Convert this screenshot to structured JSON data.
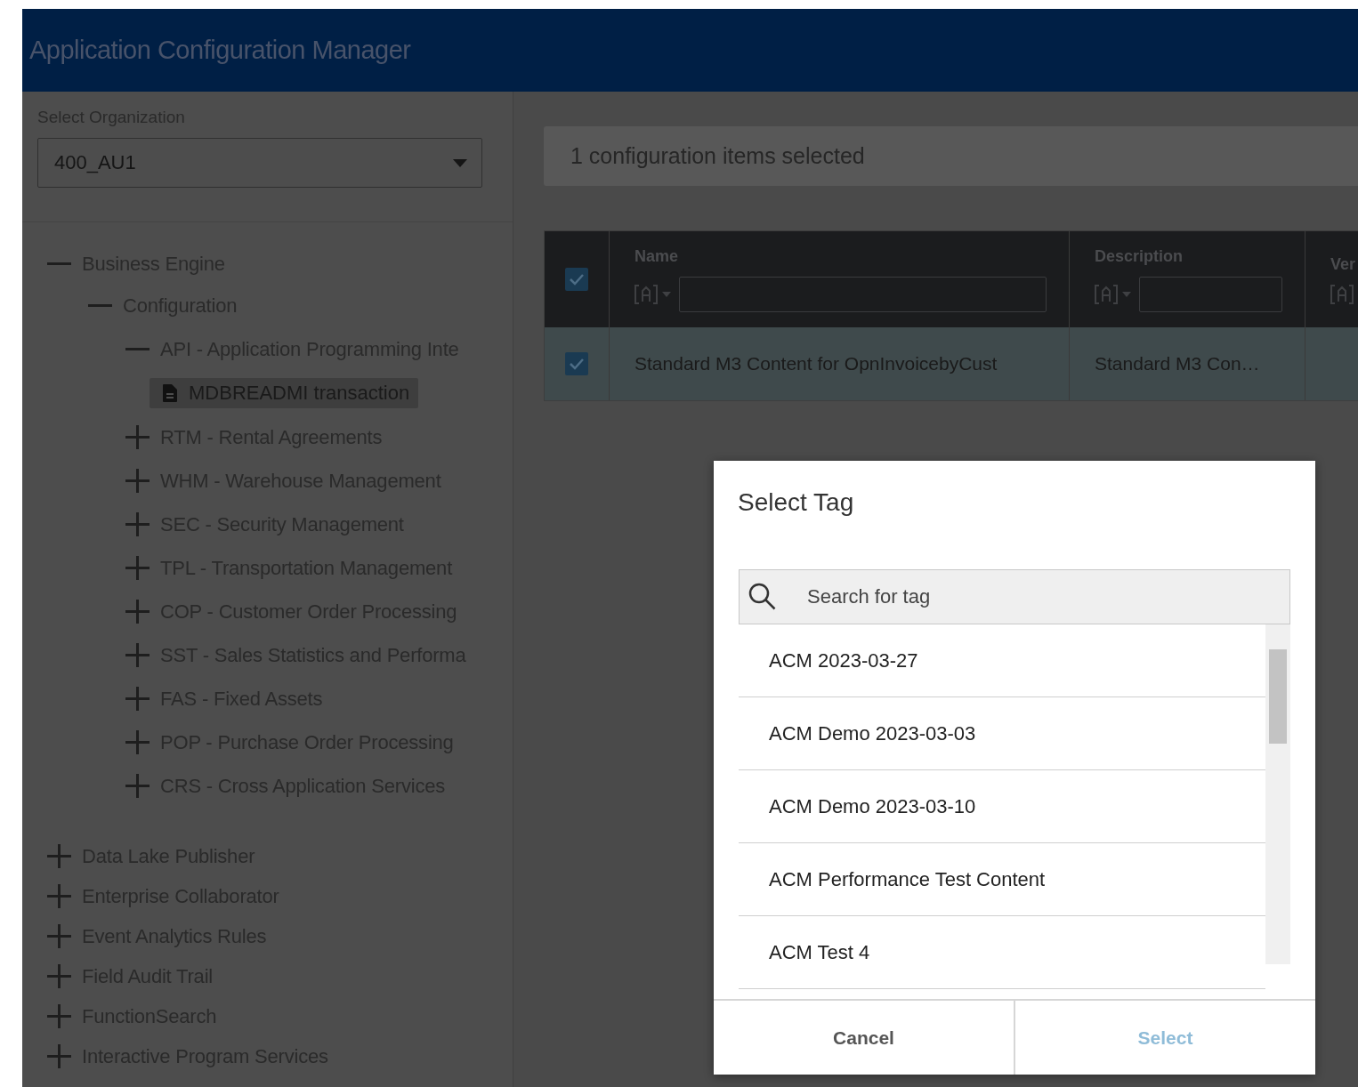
{
  "header": {
    "title": "Application Configuration Manager"
  },
  "organization": {
    "label": "Select Organization",
    "value": "400_AU1"
  },
  "tree": [
    {
      "kind": "branch",
      "label": "Business Engine",
      "expanded": true,
      "children": [
        {
          "kind": "branch",
          "label": "Configuration",
          "expanded": true,
          "children": [
            {
              "kind": "branch",
              "label": "API - Application Programming Inte",
              "expanded": true,
              "children": [
                {
                  "kind": "leaf",
                  "label": "MDBREADMI transaction",
                  "selected": true
                }
              ]
            },
            {
              "kind": "branch",
              "label": "RTM - Rental Agreements",
              "expanded": false
            },
            {
              "kind": "branch",
              "label": "WHM - Warehouse Management",
              "expanded": false
            },
            {
              "kind": "branch",
              "label": "SEC - Security Management",
              "expanded": false
            },
            {
              "kind": "branch",
              "label": "TPL - Transportation Management",
              "expanded": false
            },
            {
              "kind": "branch",
              "label": "COP - Customer Order Processing",
              "expanded": false
            },
            {
              "kind": "branch",
              "label": "SST - Sales Statistics and Performa",
              "expanded": false
            },
            {
              "kind": "branch",
              "label": "FAS - Fixed Assets",
              "expanded": false
            },
            {
              "kind": "branch",
              "label": "POP - Purchase Order Processing",
              "expanded": false
            },
            {
              "kind": "branch",
              "label": "CRS - Cross Application Services",
              "expanded": false
            }
          ]
        }
      ]
    },
    {
      "kind": "branch",
      "label": "Data Lake Publisher",
      "expanded": false
    },
    {
      "kind": "branch",
      "label": "Enterprise Collaborator",
      "expanded": false
    },
    {
      "kind": "branch",
      "label": "Event Analytics Rules",
      "expanded": false
    },
    {
      "kind": "branch",
      "label": "Field Audit Trail",
      "expanded": false
    },
    {
      "kind": "branch",
      "label": "FunctionSearch",
      "expanded": false
    },
    {
      "kind": "branch",
      "label": "Interactive Program Services",
      "expanded": false
    }
  ],
  "banner": "1 configuration items selected",
  "table": {
    "all_checked": true,
    "columns": [
      "Name",
      "Description",
      "Ver"
    ],
    "rows": [
      {
        "checked": true,
        "selected": true,
        "cells": [
          "Standard M3 Content for OpnInvoicebyCust",
          "Standard M3 Con…",
          ""
        ]
      }
    ]
  },
  "dialog": {
    "title": "Select Tag",
    "search": {
      "placeholder": "Search for tag"
    },
    "tags": [
      "ACM 2023-03-27",
      "ACM Demo 2023-03-03",
      "ACM Demo 2023-03-10",
      "ACM Performance Test Content",
      "ACM Test 4"
    ],
    "buttons": [
      {
        "label": "Cancel",
        "disabled": false
      },
      {
        "label": "Select",
        "disabled": true
      }
    ]
  }
}
